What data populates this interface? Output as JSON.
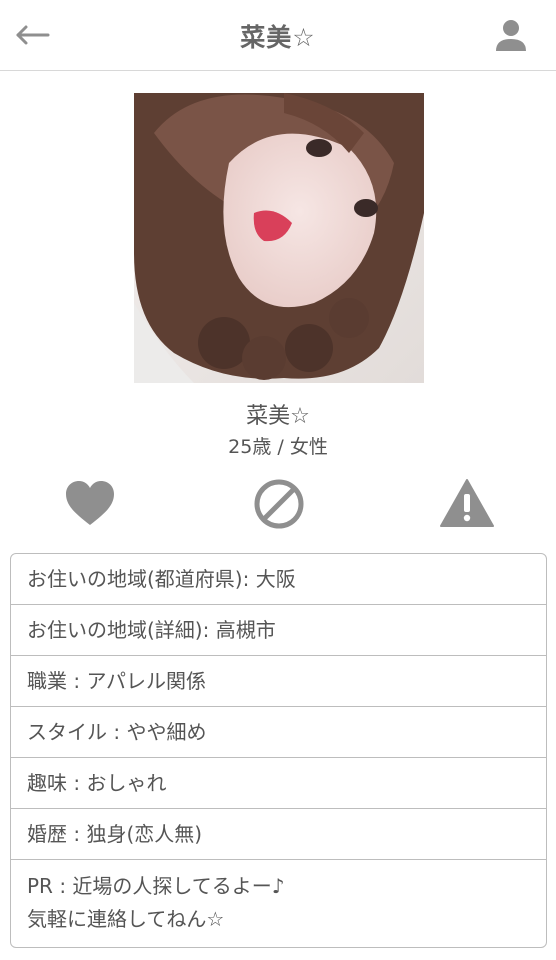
{
  "header": {
    "title": "菜美☆",
    "back_icon": "arrow-left-icon",
    "profile_icon": "person-icon"
  },
  "profile": {
    "name": "菜美☆",
    "age_gender": "25歳 / 女性"
  },
  "actions": {
    "like_icon": "heart-icon",
    "block_icon": "prohibited-icon",
    "report_icon": "warning-icon"
  },
  "details": [
    "お住いの地域(都道府県): 大阪",
    "お住いの地域(詳細): 高槻市",
    "職業 : アパレル関係",
    "スタイル : やや細め",
    "趣味 : おしゃれ",
    "婚歴 : 独身(恋人無)"
  ],
  "pr": {
    "line1": "PR : 近場の人探してるよー♪",
    "line2": "気軽に連絡してねん☆"
  },
  "colors": {
    "icon_gray": "#8f8f8f",
    "text": "#555555",
    "border": "#bdbdbd"
  }
}
